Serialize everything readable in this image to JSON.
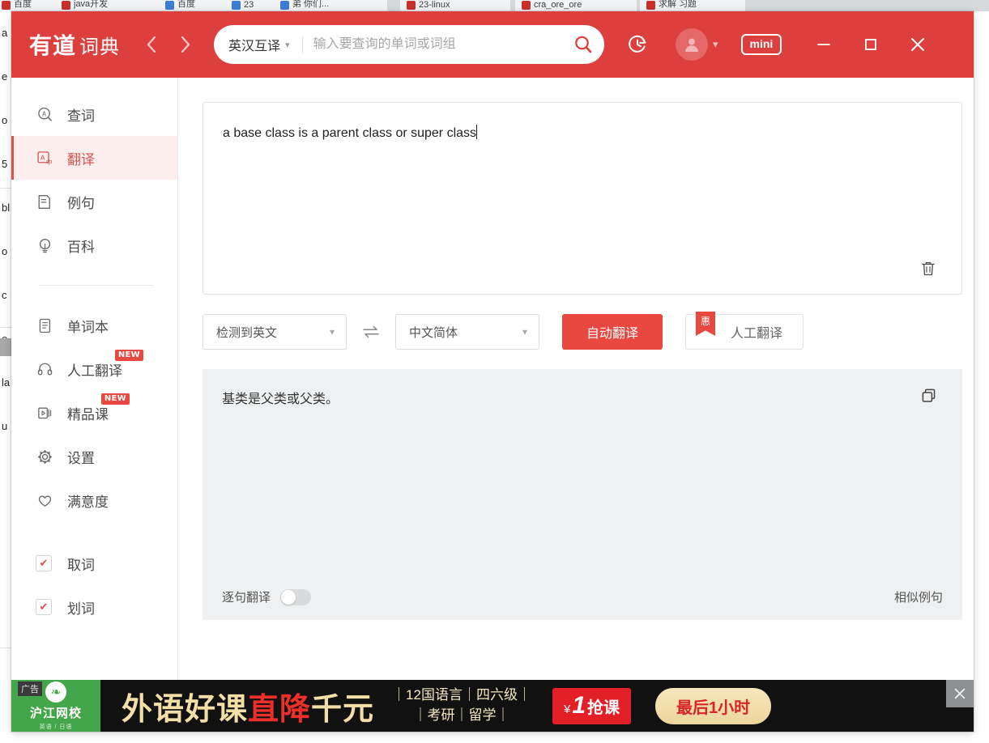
{
  "background": {
    "tabs": [
      {
        "label": "百度",
        "favicon": "white"
      },
      {
        "label": "java开发",
        "favicon": "red"
      },
      {
        "label": "百度",
        "favicon": "blue"
      },
      {
        "label": "23",
        "favicon": "blue"
      },
      {
        "label": "弟 你们...",
        "favicon": "blue"
      },
      {
        "label": "23-linux",
        "favicon": "red"
      },
      {
        "label": "cra_ore_ore",
        "favicon": "red"
      },
      {
        "label": "求解 习题",
        "favicon": "red"
      }
    ],
    "page_fragments": [
      "a",
      "e",
      "o",
      "5",
      "bl",
      "o",
      "c",
      "o",
      "la",
      "u"
    ]
  },
  "titlebar": {
    "logo_mark": "有道",
    "logo_word": "词典",
    "back_icon": "chevron-left-icon",
    "forward_icon": "chevron-right-icon",
    "dict_mode": "英汉互译",
    "search_value": "",
    "search_placeholder": "输入要查询的单词或词组",
    "search_icon": "search-icon",
    "history_icon": "history-clock-icon",
    "avatar_icon": "user-avatar-icon",
    "mini_label": "mini",
    "minimize_label": "—",
    "maximize_label": "▢",
    "close_label": "✕",
    "accent_color": "#dd3e3e"
  },
  "sidebar": {
    "items": [
      {
        "label": "查词",
        "icon": "search-word-icon",
        "active": false,
        "badge": ""
      },
      {
        "label": "翻译",
        "icon": "translate-icon",
        "active": true,
        "badge": ""
      },
      {
        "label": "例句",
        "icon": "example-sentence-icon",
        "active": false,
        "badge": ""
      },
      {
        "label": "百科",
        "icon": "lightbulb-icon",
        "active": false,
        "badge": ""
      }
    ],
    "items2": [
      {
        "label": "单词本",
        "icon": "notebook-icon",
        "badge": ""
      },
      {
        "label": "人工翻译",
        "icon": "headset-icon",
        "badge": "NEW"
      },
      {
        "label": "精品课",
        "icon": "video-course-icon",
        "badge": "NEW"
      },
      {
        "label": "设置",
        "icon": "gear-icon",
        "badge": ""
      },
      {
        "label": "满意度",
        "icon": "heart-icon",
        "badge": ""
      }
    ],
    "checks": [
      {
        "label": "取词",
        "checked": true
      },
      {
        "label": "划词",
        "checked": true
      }
    ],
    "active_color": "#d9534f",
    "active_bg": "#fdeeee"
  },
  "translator": {
    "source_text": "a base class is a parent class or super class",
    "clear_icon": "trash-icon",
    "source_lang": "检测到英文",
    "target_lang": "中文简体",
    "swap_icon": "swap-arrows-icon",
    "auto_translate_label": "自动翻译",
    "human_translate_label": "人工翻译",
    "human_translate_ribbon": "惠",
    "result_text": "基类是父类或父类。",
    "copy_icon": "copy-icon",
    "sentence_toggle_label": "逐句翻译",
    "sentence_toggle_on": false,
    "similar_examples_label": "相似例句",
    "primary_color": "#e8483f",
    "result_bg": "#eef0f1"
  },
  "ad": {
    "tag": "广告",
    "brand": "沪江网校",
    "brand_sub": "英语 / 日语",
    "brand_icon": "leaf-icon",
    "slogan_gold_1": "外语好课",
    "slogan_red": "直降",
    "slogan_gold_2": "千元",
    "col_line1": "｜12国语言｜四六级｜",
    "col_line2": "｜考研｜留学｜",
    "price_yen": "¥",
    "price_num": "1",
    "price_grab": "抢课",
    "cta": "最后1小时",
    "close_icon": "close-icon"
  }
}
